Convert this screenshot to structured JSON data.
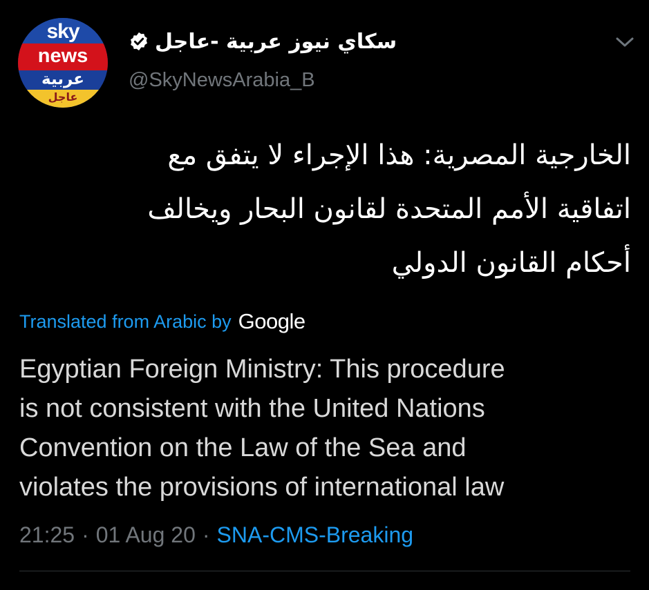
{
  "account": {
    "display_name": "سكاي نيوز عربية -عاجل",
    "handle": "@SkyNewsArabia_B",
    "verified": true,
    "avatar": {
      "line1": "sky",
      "line2": "news",
      "line3": "عربية",
      "line4": "عاجل"
    }
  },
  "tweet": {
    "text_lines": [
      "الخارجية المصرية: هذا الإجراء لا يتفق مع",
      "اتفاقية الأمم المتحدة لقانون البحار ويخالف",
      "أحكام القانون الدولي"
    ],
    "translated_label": "Translated from Arabic by",
    "translator": "Google",
    "translation_lines": [
      "Egyptian Foreign Ministry: This procedure",
      "is not consistent with the United Nations",
      "Convention on the Law of the Sea and",
      "violates the provisions of international law"
    ],
    "time": "21:25",
    "date": "01 Aug 20",
    "separator": "·",
    "source": "SNA-CMS-Breaking"
  },
  "icons": {
    "verified": "verified-badge-icon",
    "caret": "chevron-down-icon"
  },
  "colors": {
    "background": "#000000",
    "primary_text": "#ffffff",
    "secondary_text": "#71767b",
    "link": "#1d9bf0",
    "divider": "#2f3336"
  }
}
